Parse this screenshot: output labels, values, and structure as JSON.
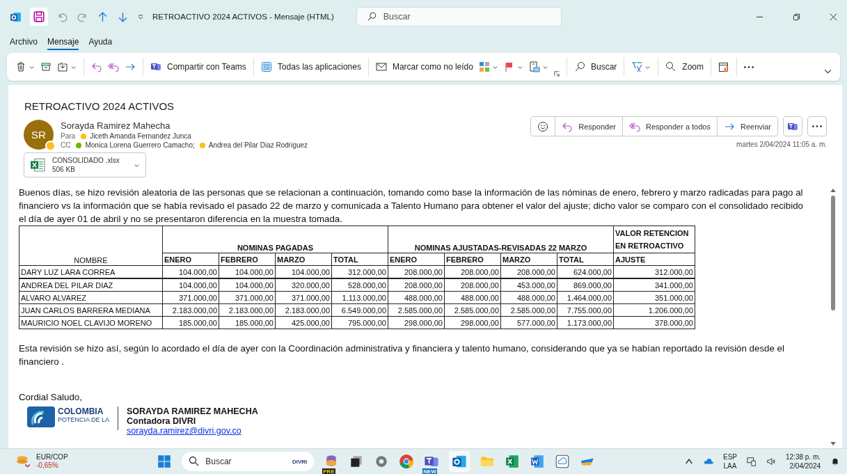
{
  "title_bar": {
    "title": "RETROACTIVO 2024 ACTIVOS  -  Mensaje (HTML)",
    "search": {
      "placeholder": "Buscar"
    }
  },
  "menu": [
    {
      "label": "Archivo",
      "selected": false
    },
    {
      "label": "Mensaje",
      "selected": true
    },
    {
      "label": "Ayuda",
      "selected": false
    }
  ],
  "ribbon": {
    "labels": [
      "Compartir con Teams",
      "Todas las aplicaciones",
      "Marcar como no leído",
      "Buscar",
      "Zoom"
    ]
  },
  "message": {
    "subject": "RETROACTIVO 2024 ACTIVOS",
    "sender": {
      "initials": "SR",
      "name": "Sorayda Ramirez Mahecha",
      "color": "#f8c21c"
    },
    "to_label": "Para",
    "to": [
      {
        "name": "Jiceth Amanda Fernandez Junca",
        "color": "#f8c21c"
      }
    ],
    "cc_label": "CC",
    "cc": [
      {
        "name": "Monica Lorena Guerrero Camacho;",
        "color": "#6bb700"
      },
      {
        "name": "Andrea del Pilar Diaz Rodriguez",
        "color": "#f8c21c"
      }
    ],
    "attachment": {
      "name": "CONSOLIDADO .xlsx",
      "size": "506 KB"
    },
    "actions": [
      "Responder",
      "Responder a todos",
      "Reenviar"
    ],
    "date": "martes 2/04/2024 11:05 a. m."
  },
  "body": {
    "intro": "Buenos días, se hizo revisión aleatoria de las personas que se relacionan a continuación, tomando como base la información de las nóminas de enero, febrero y marzo radicadas para pago al financiero vs la información que se había revisado el pasado 22 de marzo y comunicada a Talento Humano para obtener el valor del ajuste; dicho valor se comparo con el consolidado recibido el día de ayer 01 de abril y no se presentaron diferencia en la muestra tomada.",
    "table": {
      "name_header": "NOMBRE",
      "groups": [
        {
          "title": "NOMINAS PAGADAS",
          "columns": [
            "ENERO",
            "FEBRERO",
            "MARZO",
            "TOTAL"
          ]
        },
        {
          "title": "NOMINAS AJUSTADAS-REVISADAS 22 MARZO",
          "columns": [
            "ENERO",
            "FEBRERO",
            "MARZO",
            "TOTAL"
          ]
        },
        {
          "title": "VALOR RETENCION EN RETROACTIVO",
          "columns": [
            "AJUSTE"
          ]
        }
      ],
      "rows": [
        {
          "name": " DARY LUZ LARA CORREA",
          "values": [
            "104.000,00",
            "104.000,00",
            "104.000,00",
            "312.000,00",
            "208.000,00",
            "208.000,00",
            "208.000,00",
            "624.000,00",
            "312.000,00"
          ]
        },
        {
          "name": "ANDREA DEL PILAR DIAZ",
          "values": [
            "104.000,00",
            "104.000,00",
            "320.000,00",
            "528.000,00",
            "208.000,00",
            "208.000,00",
            "453.000,00",
            "869.000,00",
            "341.000,00"
          ]
        },
        {
          "name": "ALVARO ALVAREZ",
          "values": [
            "371.000,00",
            "371.000,00",
            "371.000,00",
            "1.113.000,00",
            "488.000,00",
            "488.000,00",
            "488.000,00",
            "1.464.000,00",
            "351.000,00"
          ]
        },
        {
          "name": "JUAN CARLOS BARRERA MEDIANA",
          "values": [
            "2.183.000,00",
            "2.183.000,00",
            "2.183.000,00",
            "6.549.000,00",
            "2.585.000,00",
            "2.585.000,00",
            "2.585.000,00",
            "7.755.000,00",
            "1.206.000,00"
          ]
        },
        {
          "name": "MAURICIO NOEL CLAVIJO MORENO",
          "values": [
            "185.000,00",
            "185.000,00",
            "425.000,00",
            "795.000,00",
            "298.000,00",
            "298.000,00",
            "577.000,00",
            "1.173.000,00",
            "378.000,00"
          ]
        }
      ]
    },
    "closing_text": "Esta revisión se hizo así, según lo acordado el día de ayer con la Coordinación administrativa y financiera y talento humano, considerando que ya se habían reportado la revisión desde el financiero .",
    "greeting": "Cordial Saludo,",
    "logo": {
      "line_1": "COLOMBIA",
      "line_2": "POTENCIA DE LA"
    },
    "signature": {
      "name": "SORAYDA RAMIREZ MAHECHA",
      "role": "Contadora DIVRI",
      "email": "sorayda.ramirez@divri.gov.co"
    }
  },
  "taskbar": {
    "weather": {
      "pair": "EUR/COP",
      "change": "-0,65%"
    },
    "search": {
      "placeholder": "Buscar",
      "badge": "DIVRI"
    },
    "badges": [
      "PRE",
      "NEW"
    ],
    "language": [
      "ESP",
      "LAA"
    ],
    "time": "12:38 p. m.",
    "date": "2/04/2024"
  }
}
